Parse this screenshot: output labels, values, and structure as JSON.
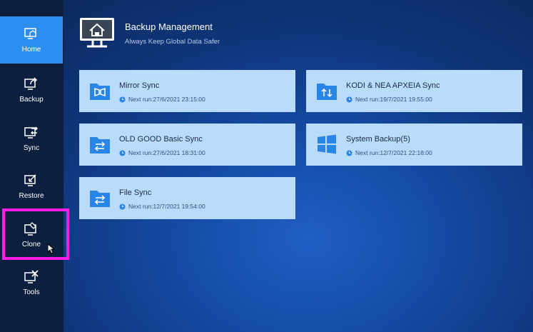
{
  "sidebar": {
    "items": [
      {
        "label": "Home",
        "icon": "home-icon",
        "active": true
      },
      {
        "label": "Backup",
        "icon": "backup-icon"
      },
      {
        "label": "Sync",
        "icon": "sync-icon"
      },
      {
        "label": "Restore",
        "icon": "restore-icon"
      },
      {
        "label": "Clone",
        "icon": "clone-icon"
      },
      {
        "label": "Tools",
        "icon": "tools-icon"
      }
    ]
  },
  "header": {
    "title": "Backup Management",
    "subtitle": "Always Keep Global Data Safer"
  },
  "cards": [
    {
      "title": "Mirror Sync",
      "next_run": "Next run:27/6/2021 23:15:00",
      "icon": "mirror-sync-folder-icon"
    },
    {
      "title": "KODI & NEA APXEIA Sync",
      "next_run": "Next run:19/7/2021 19:55:00",
      "icon": "two-way-sync-folder-icon"
    },
    {
      "title": "OLD GOOD Basic Sync",
      "next_run": "Next run:27/6/2021 18:31:00",
      "icon": "basic-sync-folder-icon"
    },
    {
      "title": "System Backup(5)",
      "next_run": "Next run:12/7/2021 22:18:00",
      "icon": "windows-logo-icon"
    },
    {
      "title": "File Sync",
      "next_run": "Next run:12/7/2021 19:54:00",
      "icon": "file-sync-folder-icon"
    }
  ],
  "colors": {
    "sidebar_bg": "#0c1f3f",
    "active_nav": "#2b8ef0",
    "card_bg": "#b9dcfc",
    "icon_blue": "#2a86e6",
    "highlight": "#ff1ee6"
  }
}
